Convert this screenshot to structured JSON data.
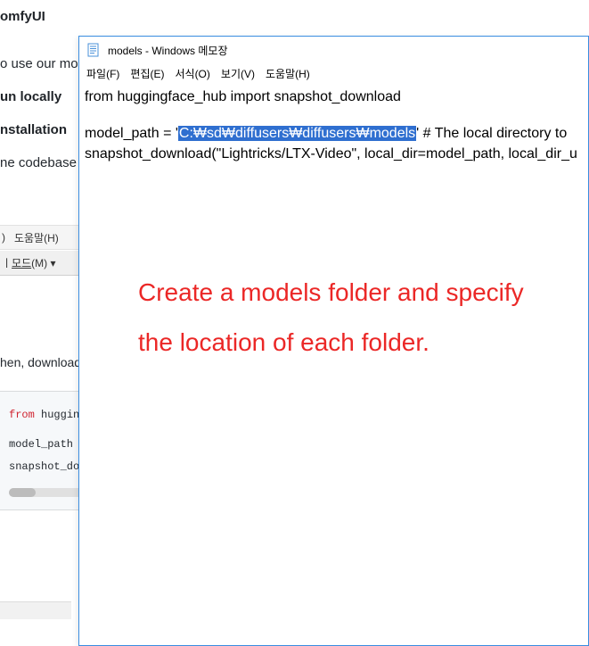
{
  "background": {
    "heading1": "omfyUI",
    "text1": "o use our mode",
    "heading2": "un locally",
    "heading3": "nstallation",
    "text2": "ne codebase wa",
    "inner_menu_help": "도움말(H)",
    "inner_mode_prefix": "ㅣ ",
    "inner_mode": "모드",
    "inner_mode_suffix": "(M)",
    "inner_mode_arrow": " ▾",
    "text3": "hen, download",
    "code_kw": "from",
    "code_rest1": " hugging",
    "code_line2": "model_path =",
    "code_line3": "snapshot_dow",
    "inner_menu_divider": ")"
  },
  "notepad": {
    "title": "models - Windows 메모장",
    "menu": {
      "file": "파일(F)",
      "edit": "편집(E)",
      "format": "서식(O)",
      "view": "보기(V)",
      "help": "도움말(H)"
    },
    "line1": "from huggingface_hub import snapshot_download",
    "line2_pre": "model_path = '",
    "line2_sel": "C:\\sd\\diffusers\\diffusers\\models",
    "line2_sel_display": "C:₩sd₩diffusers₩diffusers₩models",
    "line2_post": "'",
    "line2_comment": "   # The local directory to ",
    "line3": "snapshot_download(\"Lightricks/LTX-Video\", local_dir=model_path, local_dir_u"
  },
  "annotation": {
    "text": "Create a models folder and specify the location of each folder."
  }
}
